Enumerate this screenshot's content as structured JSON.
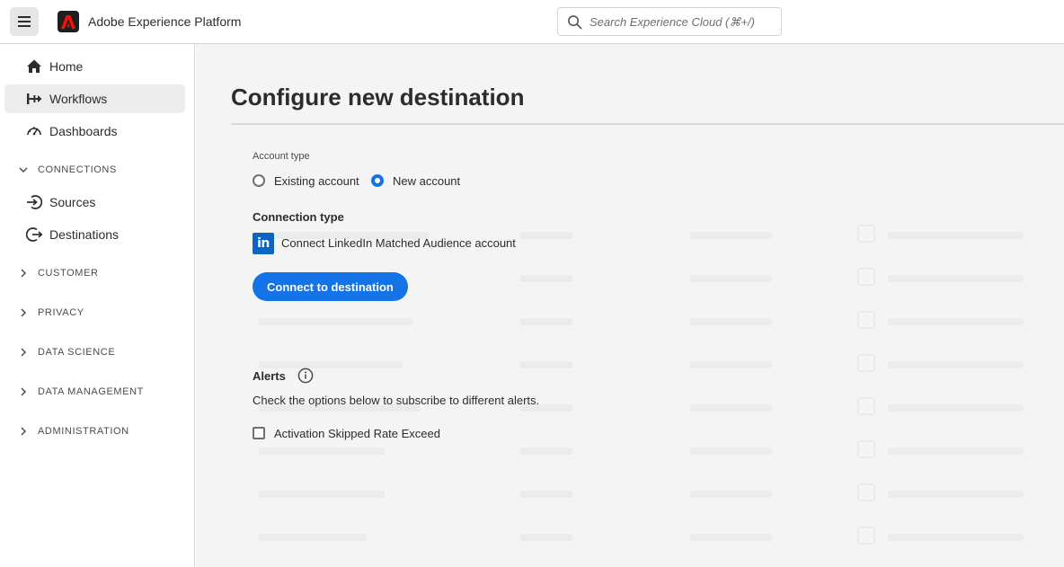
{
  "header": {
    "app_title": "Adobe Experience Platform",
    "search_placeholder": "Search Experience Cloud (⌘+/)",
    "brand_color": "#1e1e1e"
  },
  "sidebar": {
    "items": [
      {
        "label": "Home",
        "icon": "home-icon",
        "active": false
      },
      {
        "label": "Workflows",
        "icon": "workflows-icon",
        "active": true
      },
      {
        "label": "Dashboards",
        "icon": "dashboard-icon",
        "active": false
      }
    ],
    "connections_label": "CONNECTIONS",
    "connections_items": [
      {
        "label": "Sources",
        "icon": "sources-icon"
      },
      {
        "label": "Destinations",
        "icon": "destinations-icon"
      }
    ],
    "sections": [
      "CUSTOMER",
      "PRIVACY",
      "DATA SCIENCE",
      "DATA MANAGEMENT",
      "ADMINISTRATION"
    ]
  },
  "main": {
    "title": "Configure new destination",
    "account_type_label": "Account type",
    "account_options": [
      {
        "label": "Existing account",
        "selected": false
      },
      {
        "label": "New account",
        "selected": true
      }
    ],
    "connection_type_label": "Connection type",
    "connection_label": "Connect LinkedIn Matched Audience account",
    "linkedin_logo_text": "in",
    "connect_button": "Connect to destination",
    "alerts_title": "Alerts",
    "alerts_description": "Check the options below to subscribe to different alerts.",
    "alert_options": [
      {
        "label": "Activation Skipped Rate Exceed",
        "checked": false
      }
    ],
    "accent_color": "#1473e6",
    "linkedin_color": "#0a66c2"
  }
}
